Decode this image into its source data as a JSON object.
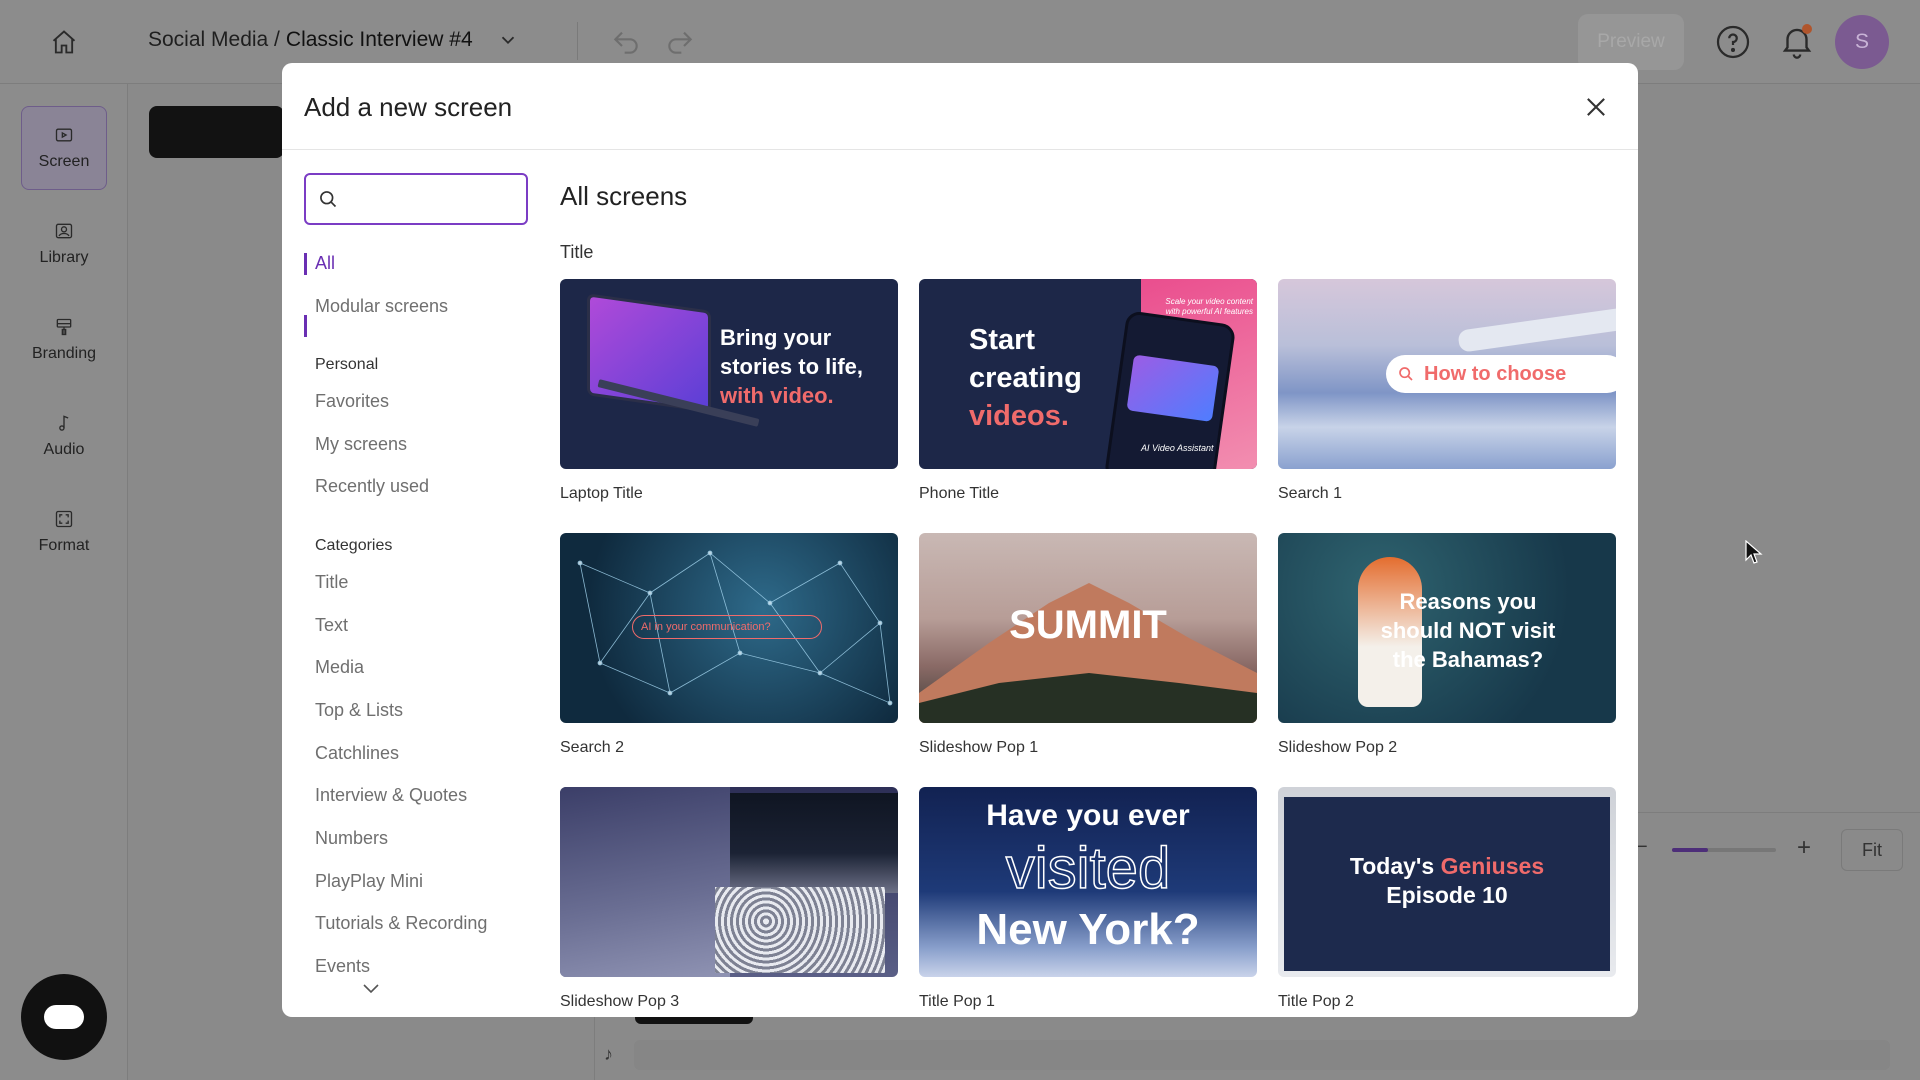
{
  "topbar": {
    "breadcrumb_prefix": "Social Media /",
    "breadcrumb_project": "Classic Interview #4",
    "preview_label": "Preview",
    "avatar_initial": "S"
  },
  "sidebar": {
    "items": [
      {
        "label": "Screen",
        "icon": "screen-icon"
      },
      {
        "label": "Library",
        "icon": "library-icon"
      },
      {
        "label": "Branding",
        "icon": "branding-icon"
      },
      {
        "label": "Audio",
        "icon": "audio-icon"
      },
      {
        "label": "Format",
        "icon": "format-icon"
      }
    ]
  },
  "zoom": {
    "fit_label": "Fit",
    "level_fraction": 0.35
  },
  "modal": {
    "title": "Add a new screen",
    "search": {
      "value": "",
      "placeholder": ""
    },
    "nav": {
      "top": [
        "All",
        "Modular screens"
      ],
      "personal_heading": "Personal",
      "personal": [
        "Favorites",
        "My screens",
        "Recently used"
      ],
      "categories_heading": "Categories",
      "categories": [
        "Title",
        "Text",
        "Media",
        "Top & Lists",
        "Catchlines",
        "Interview & Quotes",
        "Numbers",
        "PlayPlay Mini",
        "Tutorials & Recording",
        "Events"
      ]
    },
    "content_title": "All screens",
    "section_label": "Title",
    "cards": [
      {
        "label": "Laptop Title",
        "thumb": {
          "line1": "Bring your",
          "line2": "stories to life,",
          "line3": "with video."
        }
      },
      {
        "label": "Phone Title",
        "thumb": {
          "line1": "Start",
          "line2": "creating",
          "line3": "videos.",
          "phone_caption": "Scale your video content with powerful AI features",
          "phone_footer": "AI Video Assistant"
        }
      },
      {
        "label": "Search 1",
        "thumb": {
          "search_text": "How to choose"
        }
      },
      {
        "label": "Search 2",
        "thumb": {
          "search_text": "AI in your communication?"
        }
      },
      {
        "label": "Slideshow Pop 1",
        "thumb": {
          "text": "SUMMIT"
        }
      },
      {
        "label": "Slideshow Pop 2",
        "thumb": {
          "line1": "Reasons you",
          "line2": "should NOT visit",
          "line3": "the Bahamas?"
        }
      },
      {
        "label": "Slideshow Pop 3",
        "thumb": {}
      },
      {
        "label": "Title Pop 1",
        "thumb": {
          "line1": "Have you ever",
          "line2": "visited",
          "line3": "New York?"
        }
      },
      {
        "label": "Title Pop 2",
        "thumb": {
          "line1_a": "Today's",
          "line1_b": "Geniuses",
          "line2": "Episode 10"
        }
      }
    ],
    "colors": {
      "accent": "#6a2fb3",
      "coral": "#f06b6b"
    }
  }
}
